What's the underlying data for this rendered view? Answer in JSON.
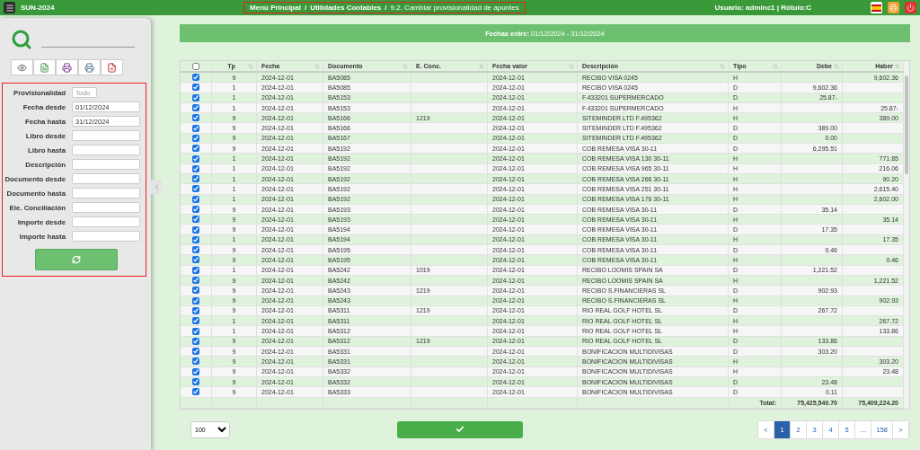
{
  "header": {
    "app_title": "SUN-2024",
    "breadcrumb": {
      "separator": "/",
      "items": [
        "Menú Principal",
        "Utilidades Contables",
        "9.2. Cambiar provisionalidad de apuntes"
      ]
    },
    "user": "Usuario: adminc1 | Rótulo:C"
  },
  "filters": {
    "fields": [
      {
        "label": "Provisionalidad",
        "kind": "select",
        "placeholder": "Todo"
      },
      {
        "label": "Fecha desde",
        "kind": "input",
        "value": "01/12/2024"
      },
      {
        "label": "Fecha hasta",
        "kind": "input",
        "value": "31/12/2024"
      },
      {
        "label": "Libro desde",
        "kind": "input"
      },
      {
        "label": "Libro hasta",
        "kind": "input"
      },
      {
        "label": "Descripción",
        "kind": "input"
      },
      {
        "label": "Documento desde",
        "kind": "input"
      },
      {
        "label": "Documento hasta",
        "kind": "input"
      },
      {
        "label": "Ele. Conciliación",
        "kind": "input"
      },
      {
        "label": "Importe desde",
        "kind": "input"
      },
      {
        "label": "Importe hasta",
        "kind": "input"
      }
    ]
  },
  "banner": "**Fechas entre:** 01/12/2024 - 31/12/2024",
  "table": {
    "select_all_checked": false,
    "columns": [
      "Tp",
      "Fecha",
      "Documento",
      "E. Conc.",
      "Fecha valor",
      "Descripción",
      "Tipo",
      "Debe",
      "Haber"
    ],
    "rows": [
      {
        "checked": true,
        "cells": [
          "9",
          "2024-12-01",
          "BA5085",
          null,
          "2024-12-01",
          "RECIBO VISA 0245",
          "H",
          null,
          "9,602.36"
        ]
      },
      {
        "checked": true,
        "cells": [
          "1",
          "2024-12-01",
          "BA5085",
          null,
          "2024-12-01",
          "RECIBO VISA 0245",
          "D",
          "9,602.36",
          null
        ]
      },
      {
        "checked": true,
        "cells": [
          "1",
          "2024-12-01",
          "BA5153",
          null,
          "2024-12-01",
          "F.433201 SUPERMERCADO",
          "D",
          "25.87-",
          null
        ]
      },
      {
        "checked": true,
        "cells": [
          "1",
          "2024-12-01",
          "BA5153",
          null,
          "2024-12-01",
          "F.433201 SUPERMERCADO",
          "H",
          null,
          "25.87-"
        ]
      },
      {
        "checked": true,
        "cells": [
          "9",
          "2024-12-01",
          "BA5166",
          "1219",
          "2024-12-01",
          "SITEMINDER LTD F.495362",
          "H",
          null,
          "389.00"
        ]
      },
      {
        "checked": true,
        "cells": [
          "9",
          "2024-12-01",
          "BA5166",
          null,
          "2024-12-01",
          "SITEMINDER LTD F.495362",
          "D",
          "389.00",
          null
        ]
      },
      {
        "checked": true,
        "cells": [
          "9",
          "2024-12-01",
          "BA5167",
          null,
          "2024-12-01",
          "SITEMINDER LTD F.495362",
          "D",
          "0.00",
          null
        ]
      },
      {
        "checked": true,
        "cells": [
          "9",
          "2024-12-01",
          "BA5192",
          null,
          "2024-12-01",
          "COB REMESA VISA 30-11",
          "D",
          "6,295.51",
          null
        ]
      },
      {
        "checked": true,
        "cells": [
          "1",
          "2024-12-01",
          "BA5192",
          null,
          "2024-12-01",
          "COB REMESA VISA 130 30-11",
          "H",
          null,
          "771.85"
        ]
      },
      {
        "checked": true,
        "cells": [
          "1",
          "2024-12-01",
          "BA5192",
          null,
          "2024-12-01",
          "COB REMESA VISA 965 30-11",
          "H",
          null,
          "216.06"
        ]
      },
      {
        "checked": true,
        "cells": [
          "1",
          "2024-12-01",
          "BA5192",
          null,
          "2024-12-01",
          "COB REMESA VISA 266 30-11",
          "H",
          null,
          "90.20"
        ]
      },
      {
        "checked": true,
        "cells": [
          "1",
          "2024-12-01",
          "BA5192",
          null,
          "2024-12-01",
          "COB REMESA VISA 251 30-11",
          "H",
          null,
          "2,615.40"
        ]
      },
      {
        "checked": true,
        "cells": [
          "1",
          "2024-12-01",
          "BA5192",
          null,
          "2024-12-01",
          "COB REMESA VISA 176 30-11",
          "H",
          null,
          "2,602.00"
        ]
      },
      {
        "checked": true,
        "cells": [
          "9",
          "2024-12-01",
          "BA5193",
          null,
          "2024-12-01",
          "COB REMESA VISA 30-11",
          "D",
          "35.14",
          null
        ]
      },
      {
        "checked": true,
        "cells": [
          "9",
          "2024-12-01",
          "BA5193",
          null,
          "2024-12-01",
          "COB REMESA VISA 30-11",
          "H",
          null,
          "35.14"
        ]
      },
      {
        "checked": true,
        "cells": [
          "9",
          "2024-12-01",
          "BA5194",
          null,
          "2024-12-01",
          "COB REMESA VISA 30-11",
          "D",
          "17.35",
          null
        ]
      },
      {
        "checked": true,
        "cells": [
          "1",
          "2024-12-01",
          "BA5194",
          null,
          "2024-12-01",
          "COB REMESA VISA 30-11",
          "H",
          null,
          "17.35"
        ]
      },
      {
        "checked": true,
        "cells": [
          "9",
          "2024-12-01",
          "BA5195",
          null,
          "2024-12-01",
          "COB REMESA VISA 30-11",
          "D",
          "0.46",
          null
        ]
      },
      {
        "checked": true,
        "cells": [
          "9",
          "2024-12-01",
          "BA5195",
          null,
          "2024-12-01",
          "COB REMESA VISA 30-11",
          "H",
          null,
          "0.46"
        ]
      },
      {
        "checked": true,
        "cells": [
          "1",
          "2024-12-01",
          "BA5242",
          "1019",
          "2024-12-01",
          "RECIBO LOOMIS SPAIN SA",
          "D",
          "1,221.52",
          null
        ]
      },
      {
        "checked": true,
        "cells": [
          "9",
          "2024-12-01",
          "BA5242",
          null,
          "2024-12-01",
          "RECIBO LOOMIS SPAIN SA",
          "H",
          null,
          "1,221.52"
        ]
      },
      {
        "checked": true,
        "cells": [
          "9",
          "2024-12-01",
          "BA5243",
          "1219",
          "2024-12-01",
          "RECIBO S.FINANCIERAS SL",
          "D",
          "902.93",
          null
        ]
      },
      {
        "checked": true,
        "cells": [
          "9",
          "2024-12-01",
          "BA5243",
          null,
          "2024-12-01",
          "RECIBO S.FINANCIERAS SL",
          "H",
          null,
          "902.93"
        ]
      },
      {
        "checked": true,
        "cells": [
          "9",
          "2024-12-01",
          "BA5311",
          "1219",
          "2024-12-01",
          "RIO REAL GOLF HOTEL SL",
          "D",
          "267.72",
          null
        ]
      },
      {
        "checked": true,
        "cells": [
          "1",
          "2024-12-01",
          "BA5311",
          null,
          "2024-12-01",
          "RIO REAL GOLF HOTEL SL",
          "H",
          null,
          "267.72"
        ]
      },
      {
        "checked": true,
        "cells": [
          "1",
          "2024-12-01",
          "BA5312",
          null,
          "2024-12-01",
          "RIO REAL GOLF HOTEL SL",
          "H",
          null,
          "133.86"
        ]
      },
      {
        "checked": true,
        "cells": [
          "9",
          "2024-12-01",
          "BA5312",
          "1219",
          "2024-12-01",
          "RIO REAL GOLF HOTEL SL",
          "D",
          "133.86",
          null
        ]
      },
      {
        "checked": true,
        "cells": [
          "9",
          "2024-12-01",
          "BA5331",
          null,
          "2024-12-01",
          "BONIFICACION MULTIDIVISAS",
          "D",
          "303.20",
          null
        ]
      },
      {
        "checked": true,
        "cells": [
          "9",
          "2024-12-01",
          "BA5331",
          null,
          "2024-12-01",
          "BONIFICACION MULTIDIVISAS",
          "H",
          null,
          "303.20"
        ]
      },
      {
        "checked": true,
        "cells": [
          "9",
          "2024-12-01",
          "BA5332",
          null,
          "2024-12-01",
          "BONIFICACION MULTIDIVISAS",
          "H",
          null,
          "23.48"
        ]
      },
      {
        "checked": true,
        "cells": [
          "9",
          "2024-12-01",
          "BA5332",
          null,
          "2024-12-01",
          "BONIFICACION MULTIDIVISAS",
          "D",
          "23.48",
          null
        ]
      },
      {
        "checked": true,
        "cells": [
          "9",
          "2024-12-01",
          "BA5333",
          null,
          "2024-12-01",
          "BONIFICACION MULTIDIVISAS",
          "D",
          "0.11",
          null
        ]
      }
    ],
    "totals": {
      "label": "Total:",
      "debe": "75,425,540.70",
      "haber": "75,409,224.20"
    }
  },
  "page_size": "100",
  "pagination": [
    {
      "label": "<",
      "selected": false
    },
    {
      "label": "1",
      "selected": true
    },
    {
      "label": "2",
      "selected": false
    },
    {
      "label": "3",
      "selected": false
    },
    {
      "label": "4",
      "selected": false
    },
    {
      "label": "5",
      "selected": false
    },
    {
      "label": "…",
      "selected": false
    },
    {
      "label": "158",
      "selected": false
    },
    {
      "label": ">",
      "selected": false
    }
  ]
}
